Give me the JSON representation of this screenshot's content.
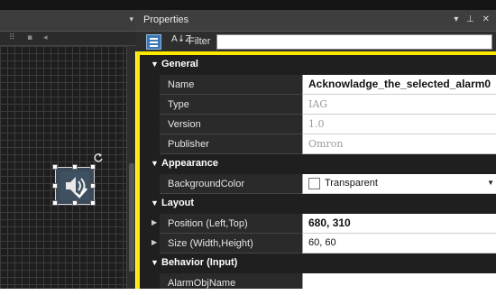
{
  "left_panel": {
    "toolbar_glyphs": [
      "⠿",
      "▪",
      "◂"
    ]
  },
  "properties": {
    "title": "Properties",
    "title_buttons": "▾ ⊥ ✕",
    "toolbar": {
      "sort_icon": "A↓Z",
      "filter_label": "Filter",
      "filter_value": ""
    },
    "categories": [
      {
        "label": "General",
        "caret": "▼",
        "rows": [
          {
            "name": "Name",
            "value": "Acknowladge_the_selected_alarm0",
            "style": "bold"
          },
          {
            "name": "Type",
            "value": "IAG",
            "style": "muted"
          },
          {
            "name": "Version",
            "value": "1.0",
            "style": "muted"
          },
          {
            "name": "Publisher",
            "value": "Omron",
            "style": "muted"
          }
        ]
      },
      {
        "label": "Appearance",
        "caret": "▼",
        "rows": [
          {
            "name": "BackgroundColor",
            "value": "Transparent",
            "style": "checkbox-dropdown"
          }
        ]
      },
      {
        "label": "Layout",
        "caret": "▼",
        "rows": [
          {
            "name": "Position (Left,Top)",
            "value": "680, 310",
            "style": "bold",
            "expander": "▶"
          },
          {
            "name": "Size (Width,Height)",
            "value": "60, 60",
            "style": "normal",
            "expander": "▶"
          }
        ]
      },
      {
        "label": "Behavior (Input)",
        "caret": "▼",
        "rows": [
          {
            "name": "AlarmObjName",
            "value": "",
            "style": "normal"
          }
        ]
      }
    ]
  },
  "colors": {
    "highlight": "#ffe800",
    "category_bg": "#1f1f1f",
    "name_cell_bg": "#2a2a2a",
    "accent": "#3c78b6"
  },
  "icons": {
    "widget": "speaker-check-icon",
    "rotate": "rotate-handle-icon"
  }
}
